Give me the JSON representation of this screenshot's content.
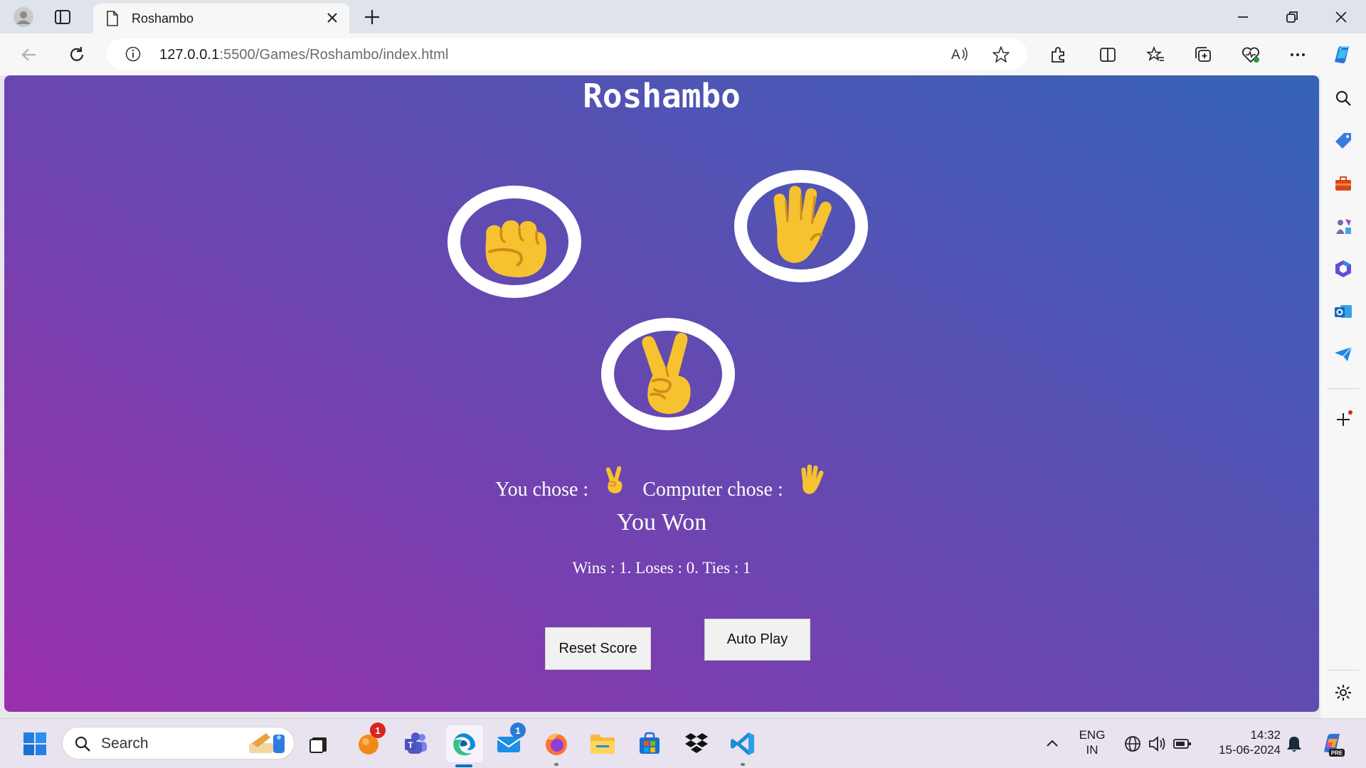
{
  "browser": {
    "tab_title": "Roshambo",
    "url_host": "127.0.0.1",
    "url_rest": ":5500/Games/Roshambo/index.html"
  },
  "game": {
    "title": "Roshambo",
    "choices": [
      {
        "name": "rock",
        "icon": "fist-icon"
      },
      {
        "name": "paper",
        "icon": "raised-hand-icon"
      },
      {
        "name": "scissors",
        "icon": "victory-hand-icon"
      }
    ],
    "you_chose_label": "You chose :",
    "computer_chose_label": "Computer chose :",
    "you_chose_icon": "victory-hand-icon",
    "computer_chose_icon": "raised-hand-icon",
    "result": "You Won",
    "score_text": "Wins : 1. Loses : 0. Ties : 1",
    "reset_label": "Reset Score",
    "autoplay_label": "Auto Play"
  },
  "taskbar": {
    "search_placeholder": "Search",
    "lang_top": "ENG",
    "lang_bottom": "IN",
    "time": "14:32",
    "date": "15-06-2024",
    "badge_orange": "1",
    "badge_mail": "1"
  },
  "colors": {
    "gradient_start": "#9b2fae",
    "gradient_end": "#3563b8",
    "emoji_yellow": "#f6c230"
  }
}
